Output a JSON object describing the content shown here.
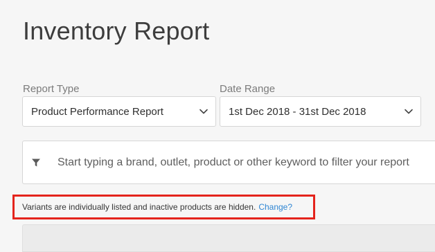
{
  "page": {
    "title": "Inventory Report"
  },
  "report_type": {
    "label": "Report Type",
    "selected": "Product Performance Report",
    "icon": "chevron-down-icon"
  },
  "date_range": {
    "label": "Date Range",
    "selected": "1st Dec 2018 - 31st Dec 2018",
    "icon": "chevron-down-icon"
  },
  "filter": {
    "icon": "filter-funnel-icon",
    "placeholder": "Start typing a brand, outlet, product or other keyword to filter your report",
    "value": ""
  },
  "notice": {
    "text": "Variants are individually listed and inactive products are hidden.",
    "link_label": "Change?",
    "highlight_color": "#e4231c",
    "link_color": "#2f86d3"
  }
}
